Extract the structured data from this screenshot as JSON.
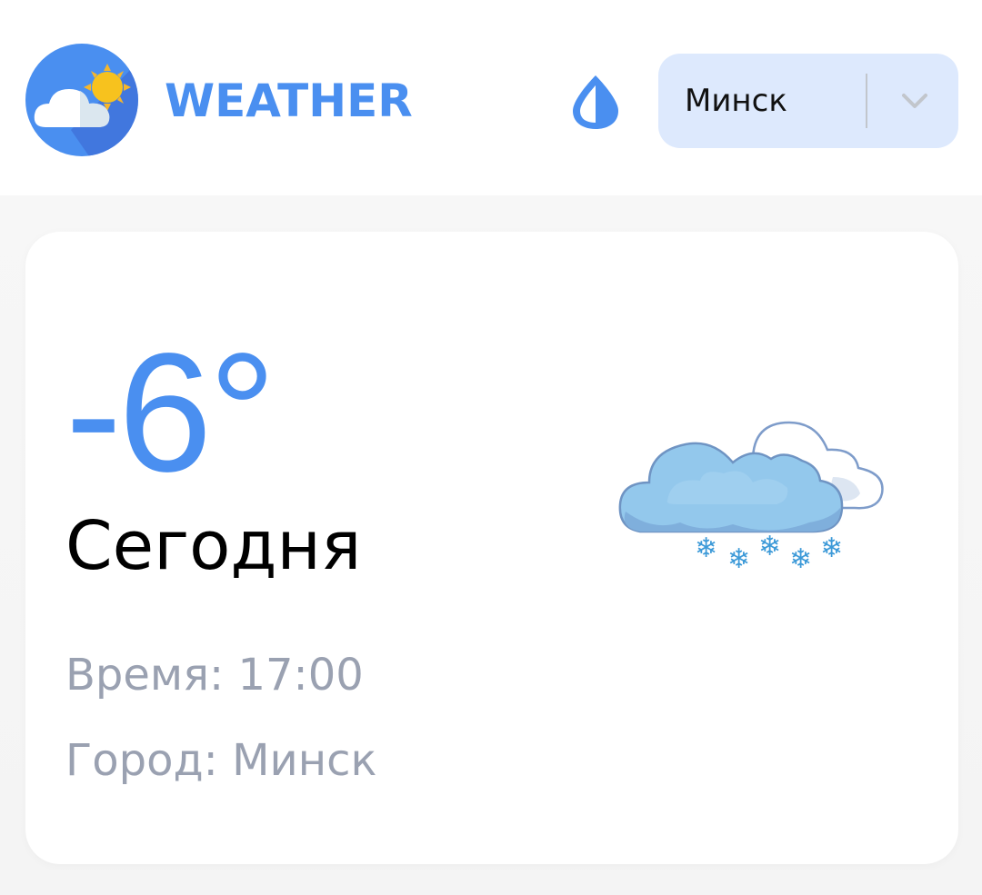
{
  "header": {
    "brand": "WEATHER",
    "logo_icon": "cloud-sun-logo-icon",
    "theme_icon": "droplet-icon",
    "city_select": {
      "value": "Минск",
      "chevron_icon": "chevron-down-icon"
    }
  },
  "current": {
    "temperature": "-6°",
    "day": "Сегодня",
    "time_line": "Время: 17:00",
    "city_line": "Город: Минск",
    "condition_icon": "cloud-snow-icon"
  },
  "colors": {
    "accent": "#4a8ff0",
    "select_bg": "#dde9fd",
    "muted_text": "#9aa1b1",
    "background": "#f4f4f4"
  }
}
